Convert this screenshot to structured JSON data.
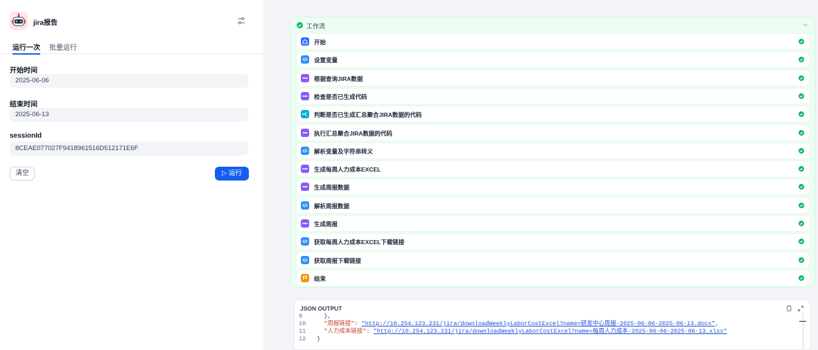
{
  "app": {
    "title": "jira报告"
  },
  "tabs": [
    "运行一次",
    "批量运行"
  ],
  "fields": [
    {
      "label": "开始时间",
      "value": "2025-06-06"
    },
    {
      "label": "结束时间",
      "value": "2025-06-13"
    },
    {
      "label": "sessionId",
      "value": "8CEAE077027F9418961516D512171E6F"
    }
  ],
  "buttons": {
    "clear": "清空",
    "run": "▷ 运行"
  },
  "workflow": {
    "title": "工作流",
    "steps": [
      {
        "label": "开始",
        "icon": "home-icon",
        "color": "#2970ff"
      },
      {
        "label": "设置变量",
        "icon": "code-icon",
        "color": "#2e90fa"
      },
      {
        "label": "根据查询JIRA数据",
        "icon": "http-icon",
        "color": "#875bf7"
      },
      {
        "label": "检查是否已生成代码",
        "icon": "http-icon",
        "color": "#875bf7"
      },
      {
        "label": "判断是否已生成汇总聚合JIRA数据的代码",
        "icon": "branch-icon",
        "color": "#06aed4"
      },
      {
        "label": "执行汇总聚合JIRA数据的代码",
        "icon": "http-icon",
        "color": "#875bf7"
      },
      {
        "label": "解析变量及字符串转义",
        "icon": "code-icon",
        "color": "#2e90fa"
      },
      {
        "label": "生成每周人力成本EXCEL",
        "icon": "http-icon",
        "color": "#875bf7"
      },
      {
        "label": "生成周报数据",
        "icon": "http-icon",
        "color": "#875bf7"
      },
      {
        "label": "解析周报数据",
        "icon": "code-icon",
        "color": "#2e90fa"
      },
      {
        "label": "生成周报",
        "icon": "http-icon",
        "color": "#875bf7"
      },
      {
        "label": "获取每周人力成本EXCEL下载链接",
        "icon": "code-icon",
        "color": "#2e90fa"
      },
      {
        "label": "获取周报下载链接",
        "icon": "code-icon",
        "color": "#2e90fa"
      },
      {
        "label": "结束",
        "icon": "end-icon",
        "color": "#f79009"
      }
    ],
    "status_color": "#12b76a"
  },
  "json_output": {
    "title": "JSON OUTPUT",
    "lines": [
      {
        "n": "9",
        "text": "  },",
        "key": "",
        "val": "",
        "tail": ""
      },
      {
        "n": "10",
        "text": "",
        "key": "\"周报链接\"",
        "val": "\"http://10.254.123.231/jira/downloadWeeklyLaborCostExcel?name=研发中心周报-2025-06-06-2025-06-13.docx\"",
        "tail": ","
      },
      {
        "n": "11",
        "text": "",
        "key": "\"人力成本链接\"",
        "val": "\"http://10.254.123.231/jira/downloadWeeklyLaborCostExcel?name=每周人力成本-2025-06-06-2025-06-13.xlsx\"",
        "tail": ""
      },
      {
        "n": "12",
        "text": "}",
        "key": "",
        "val": "",
        "tail": ""
      }
    ]
  }
}
